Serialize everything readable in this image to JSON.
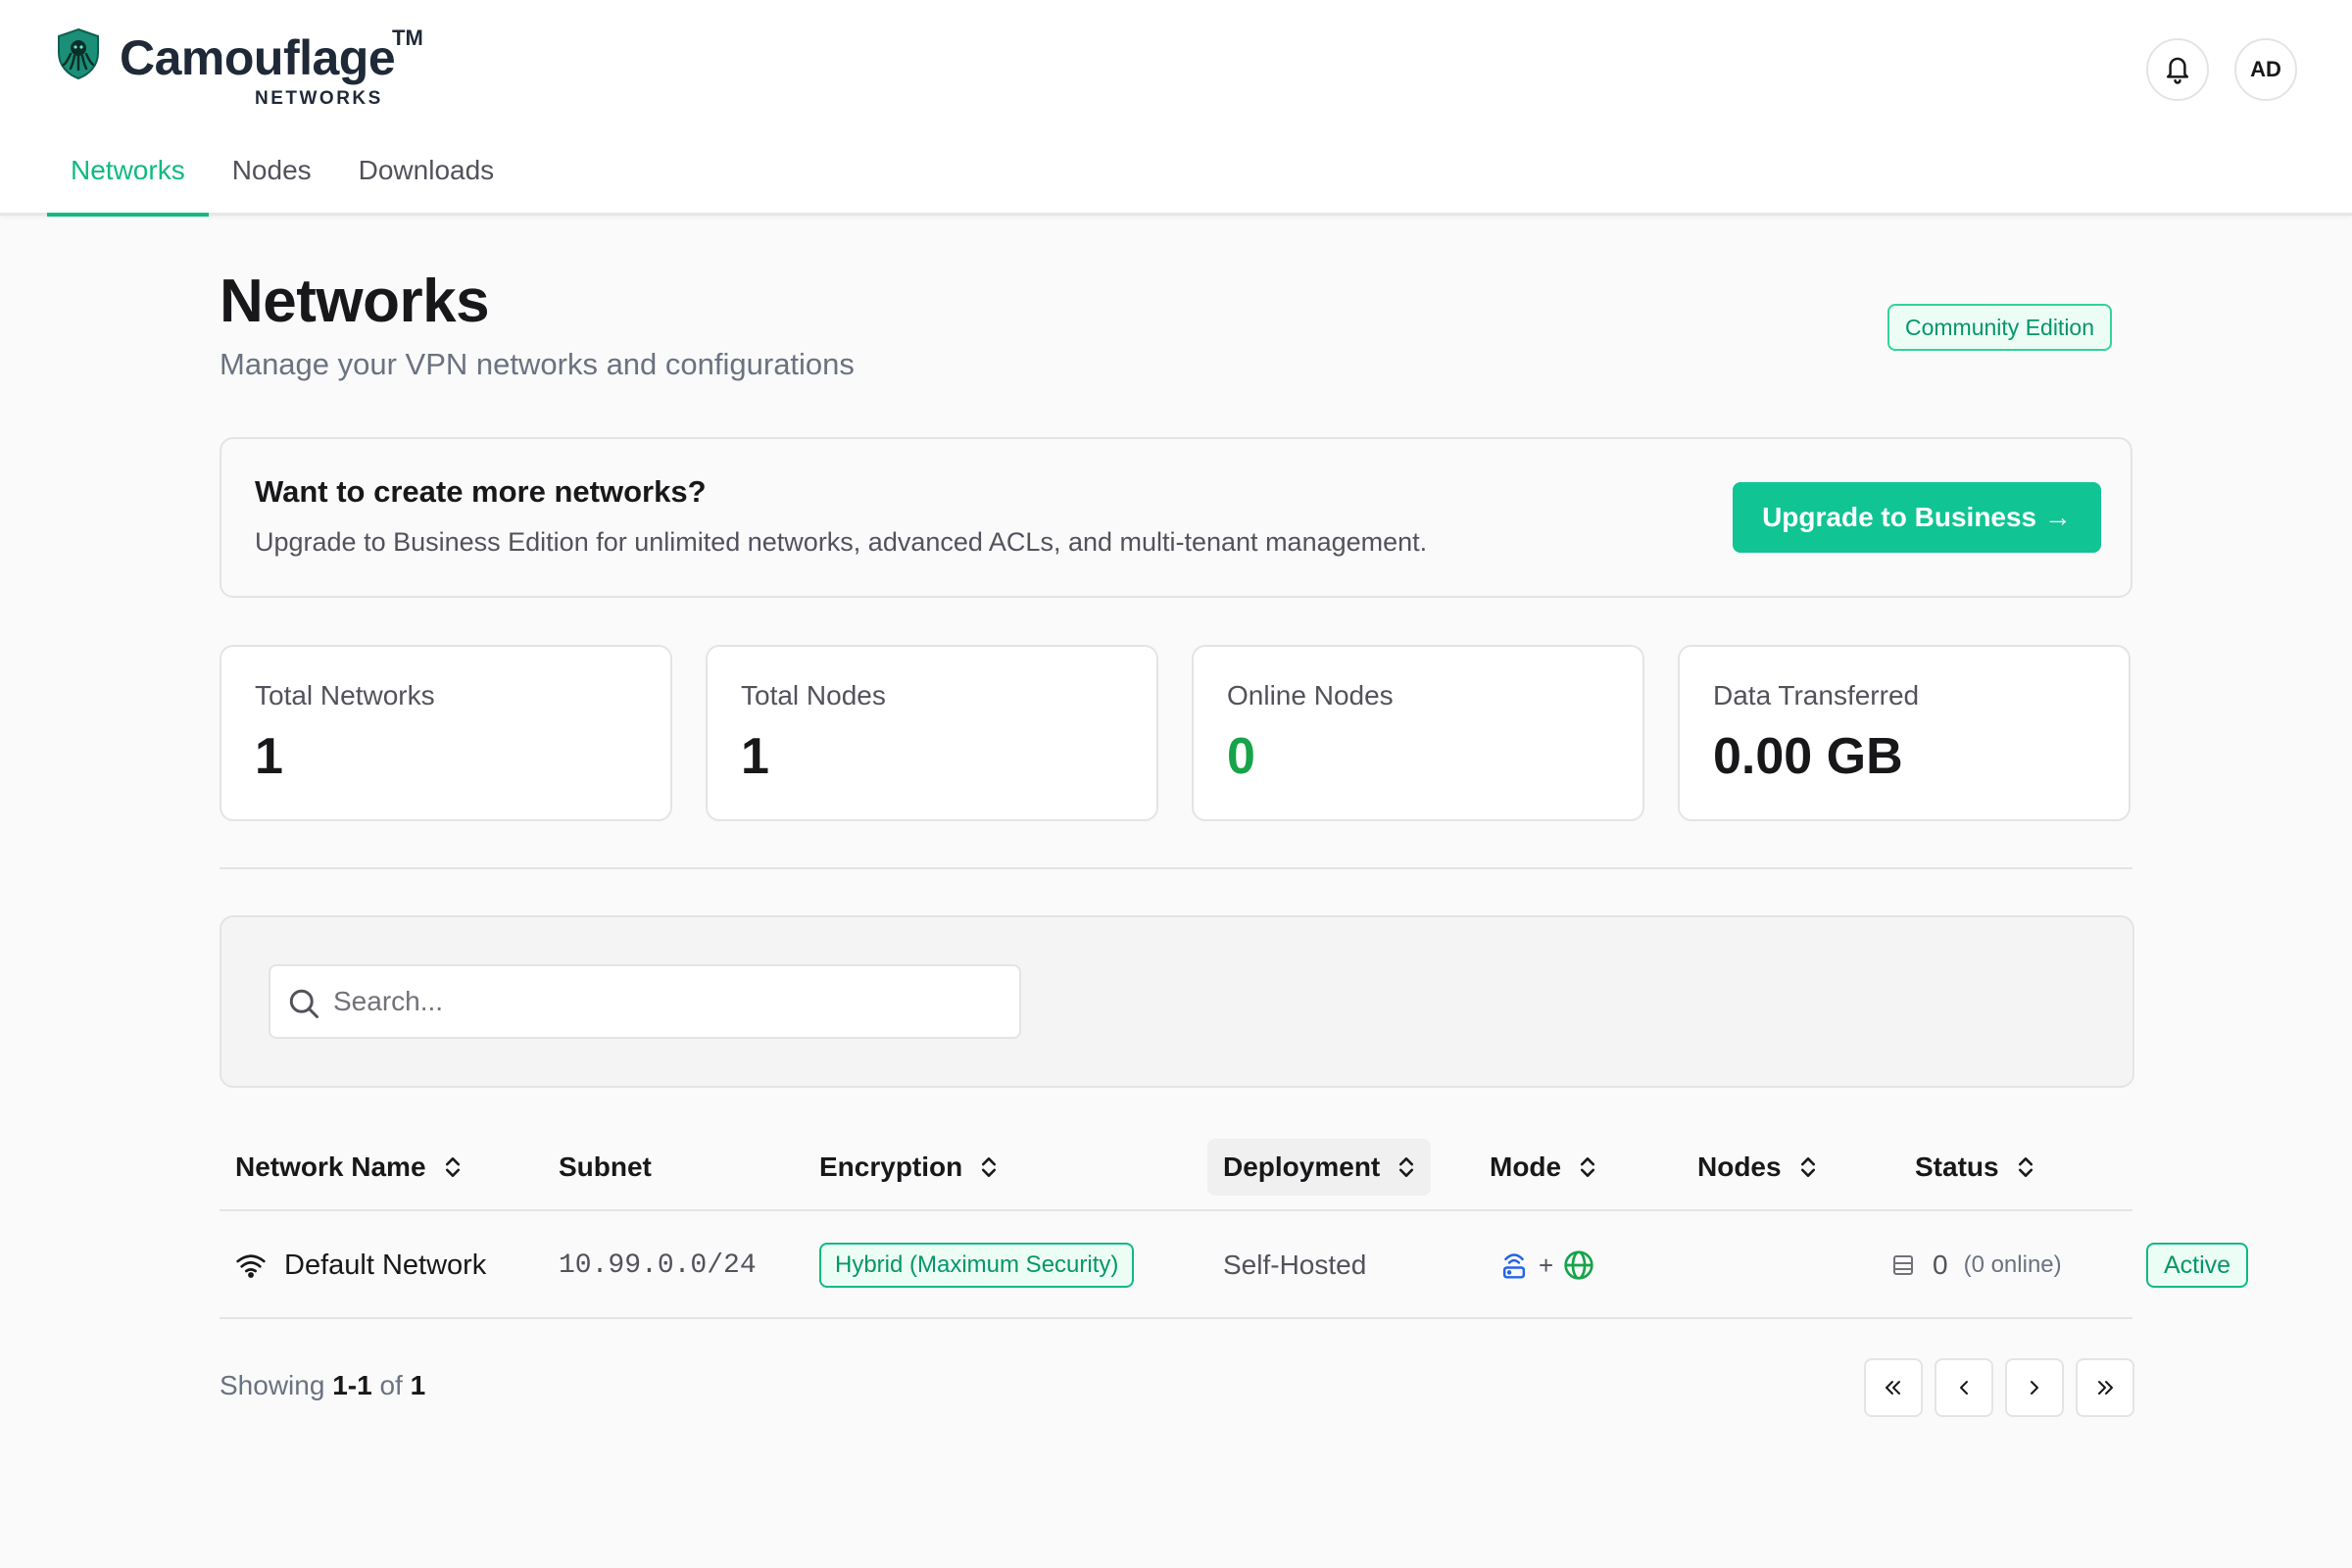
{
  "brand": {
    "name": "Camouflage",
    "trademark": "TM",
    "sub": "NETWORKS",
    "logo_icon": "octopus-shield-icon",
    "accent_color": "#10b981"
  },
  "header": {
    "notifications_icon": "bell-icon",
    "avatar_initials": "AD"
  },
  "tabs": [
    {
      "label": "Networks",
      "active": true
    },
    {
      "label": "Nodes",
      "active": false
    },
    {
      "label": "Downloads",
      "active": false
    }
  ],
  "page": {
    "title": "Networks",
    "subtitle": "Manage your VPN networks and configurations",
    "edition": "Community Edition"
  },
  "upsell": {
    "title": "Want to create more networks?",
    "text": "Upgrade to Business Edition for unlimited networks, advanced ACLs, and multi-tenant management.",
    "button_label": "Upgrade to Business →"
  },
  "stats": [
    {
      "label": "Total Networks",
      "value": "1"
    },
    {
      "label": "Total Nodes",
      "value": "1"
    },
    {
      "label": "Online Nodes",
      "value": "0"
    },
    {
      "label": "Data Transferred",
      "value": "0.00 GB"
    }
  ],
  "search": {
    "placeholder": "Search...",
    "value": ""
  },
  "table": {
    "columns": [
      {
        "label": "Network Name",
        "sortable": true
      },
      {
        "label": "Subnet",
        "sortable": false
      },
      {
        "label": "Encryption",
        "sortable": true
      },
      {
        "label": "Deployment",
        "sortable": true,
        "sorted": true
      },
      {
        "label": "Mode",
        "sortable": true
      },
      {
        "label": "Nodes",
        "sortable": true
      },
      {
        "label": "Status",
        "sortable": true
      }
    ],
    "rows": [
      {
        "name": "Default Network",
        "name_icon": "wifi-icon",
        "subnet": "10.99.0.0/24",
        "encryption": "Hybrid (Maximum Security)",
        "deployment": "Self-Hosted",
        "mode_icons": [
          "router-icon",
          "globe-icon"
        ],
        "mode_separator": "+",
        "nodes_count": "0",
        "nodes_online": "(0 online)",
        "status": "Active"
      }
    ]
  },
  "pagination": {
    "prefix": "Showing",
    "range": "1-1",
    "of": "of",
    "total": "1"
  }
}
